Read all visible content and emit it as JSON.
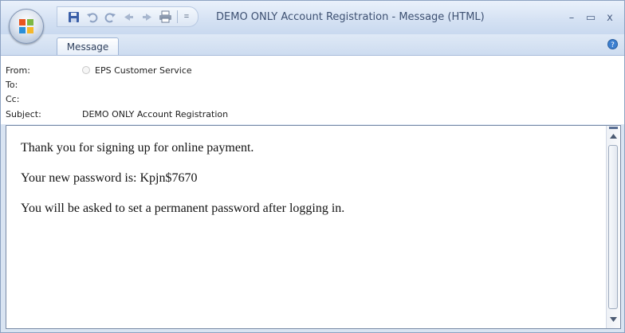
{
  "window": {
    "title": "DEMO ONLY Account Registration - Message (HTML)",
    "controls": {
      "minimize": "–",
      "maximize": "▭",
      "close": "x"
    }
  },
  "quick_access": {
    "icons": [
      "save-icon",
      "undo-icon",
      "redo-icon",
      "previous-item-icon",
      "next-item-icon",
      "print-icon"
    ],
    "more": "="
  },
  "ribbon": {
    "tabs": [
      {
        "label": "Message",
        "active": true
      }
    ]
  },
  "headers": {
    "from_label": "From:",
    "from_value": "EPS Customer Service",
    "to_label": "To:",
    "to_value": "",
    "cc_label": "Cc:",
    "cc_value": "",
    "subject_label": "Subject:",
    "subject_value": "DEMO ONLY Account Registration"
  },
  "message_body": {
    "paragraphs": [
      "Thank you for signing up for online payment.",
      "Your new password is: Kpjn$7670",
      "You will be asked to set a permanent password after logging in."
    ]
  },
  "colors": {
    "title_text": "#3e5172",
    "frame_border": "#7a8ba6",
    "ribbon_bg": "#d4e1f3"
  }
}
